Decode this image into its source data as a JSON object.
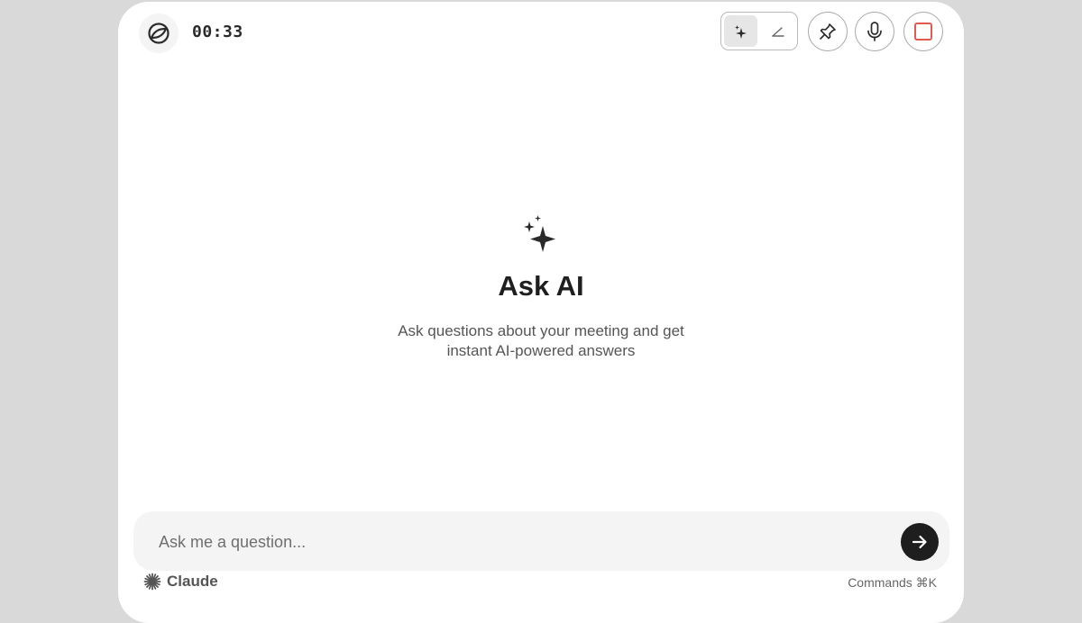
{
  "header": {
    "timer": "00:33"
  },
  "hero": {
    "title": "Ask AI",
    "subtitle_line1": "Ask questions about your meeting and get",
    "subtitle_line2": "instant AI-powered answers"
  },
  "input": {
    "placeholder": "Ask me a question...",
    "value": ""
  },
  "footer": {
    "model_name": "Claude",
    "commands_label": "Commands ⌘K"
  },
  "colors": {
    "stop_accent": "#e25a4e",
    "send_button": "#1e1e1e"
  },
  "icons": [
    "app-logo-icon",
    "sparkle-icon",
    "pen-icon",
    "pin-icon",
    "microphone-icon",
    "stop-icon",
    "arrow-right-icon",
    "claude-icon"
  ]
}
